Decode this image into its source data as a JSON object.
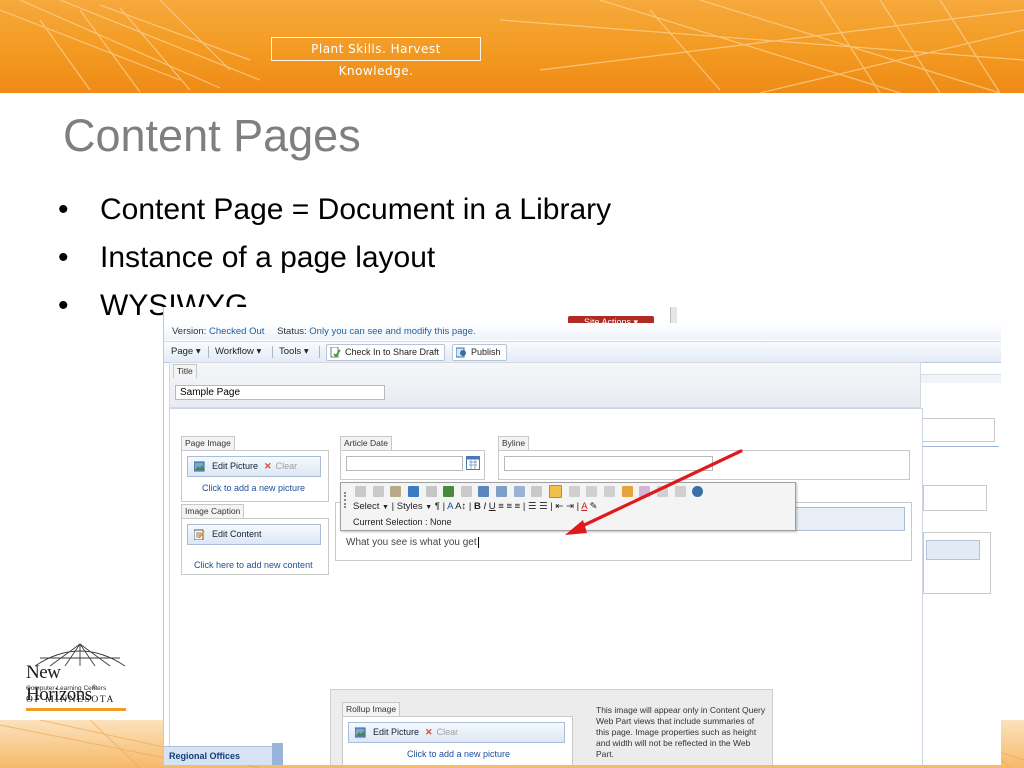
{
  "banner": {
    "tagline": "Plant Skills. Harvest Knowledge."
  },
  "slide": {
    "title": "Content Pages",
    "bullets": [
      "Content Page = Document in a Library",
      "Instance of a page layout",
      "WYSIWYG"
    ],
    "bullet_char": "•"
  },
  "logo": {
    "name": "New Horizons",
    "trademark": "®",
    "subtitle": "Computer Learning Centers",
    "region": "OF MINNESOTA"
  },
  "screenshot": {
    "site_actions": "Site Actions ▾",
    "status_bar": {
      "version_label": "Version:",
      "version_value": "Checked Out",
      "status_label": "Status:",
      "status_value": "Only you can see and modify this page."
    },
    "toolbar": {
      "page": "Page ▾",
      "workflow": "Workflow ▾",
      "tools": "Tools ▾",
      "check_in": "Check In to Share Draft",
      "publish": "Publish"
    },
    "title_field": {
      "label": "Title",
      "value": "Sample Page"
    },
    "page_image": {
      "label": "Page Image",
      "edit": "Edit Picture",
      "clear": "Clear",
      "link": "Click to add a new picture"
    },
    "image_caption": {
      "label": "Image Caption",
      "edit": "Edit Content",
      "link": "Click here to add new content"
    },
    "article_date": {
      "label": "Article Date",
      "value": ""
    },
    "byline": {
      "label": "Byline",
      "value": ""
    },
    "rte": {
      "select": "Select",
      "styles": "Styles",
      "current_selection": "Current Selection : None"
    },
    "content_text": "What you see is what you get",
    "rollup": {
      "label": "Rollup Image",
      "edit": "Edit Picture",
      "clear": "Clear",
      "link": "Click to add a new picture",
      "note": "This image will appear only in Content Query Web Part views that include summaries of this page. Image properties such as height and width will not be reflected in the Web Part."
    },
    "regional_offices": "Regional Offices"
  },
  "colors": {
    "banner_orange": "#f39a22",
    "title_gray": "#7f7f7f",
    "arrow_red": "#e0191c",
    "site_actions_red": "#b22a24"
  }
}
